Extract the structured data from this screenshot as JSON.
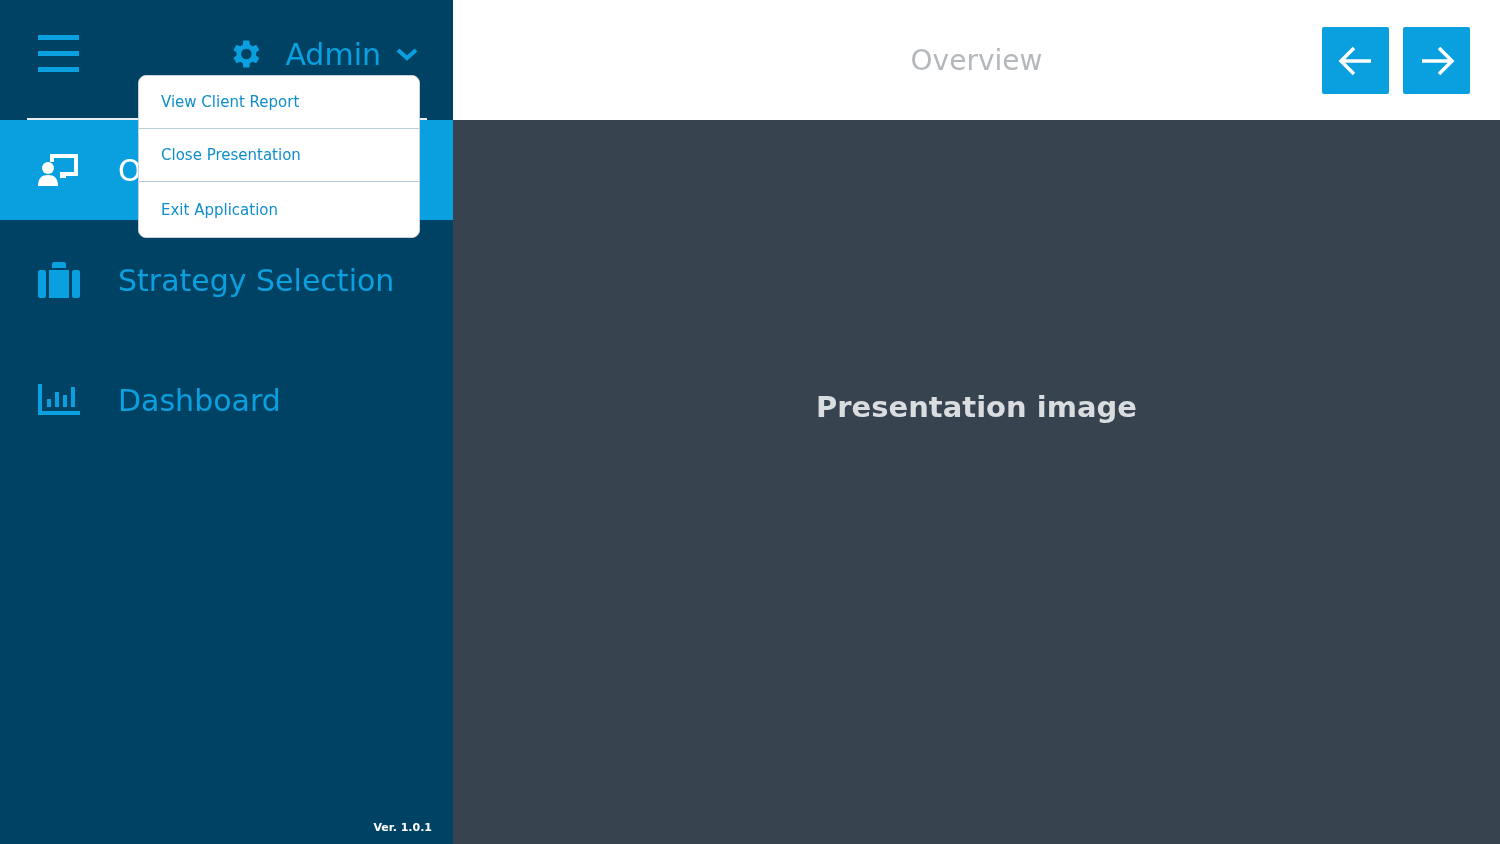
{
  "sidebar": {
    "user_menu": {
      "label": "Admin",
      "expanded": true,
      "items": [
        {
          "label": "View Client Report"
        },
        {
          "label": "Close Presentation"
        },
        {
          "label": "Exit Application"
        }
      ]
    },
    "items": [
      {
        "label": "O",
        "selected": true
      },
      {
        "label": "Strategy Selection",
        "selected": false
      },
      {
        "label": "Dashboard",
        "selected": false
      }
    ],
    "version": "Ver. 1.0.1"
  },
  "header": {
    "title": "Overview"
  },
  "content": {
    "placeholder_text": "Presentation image"
  }
}
